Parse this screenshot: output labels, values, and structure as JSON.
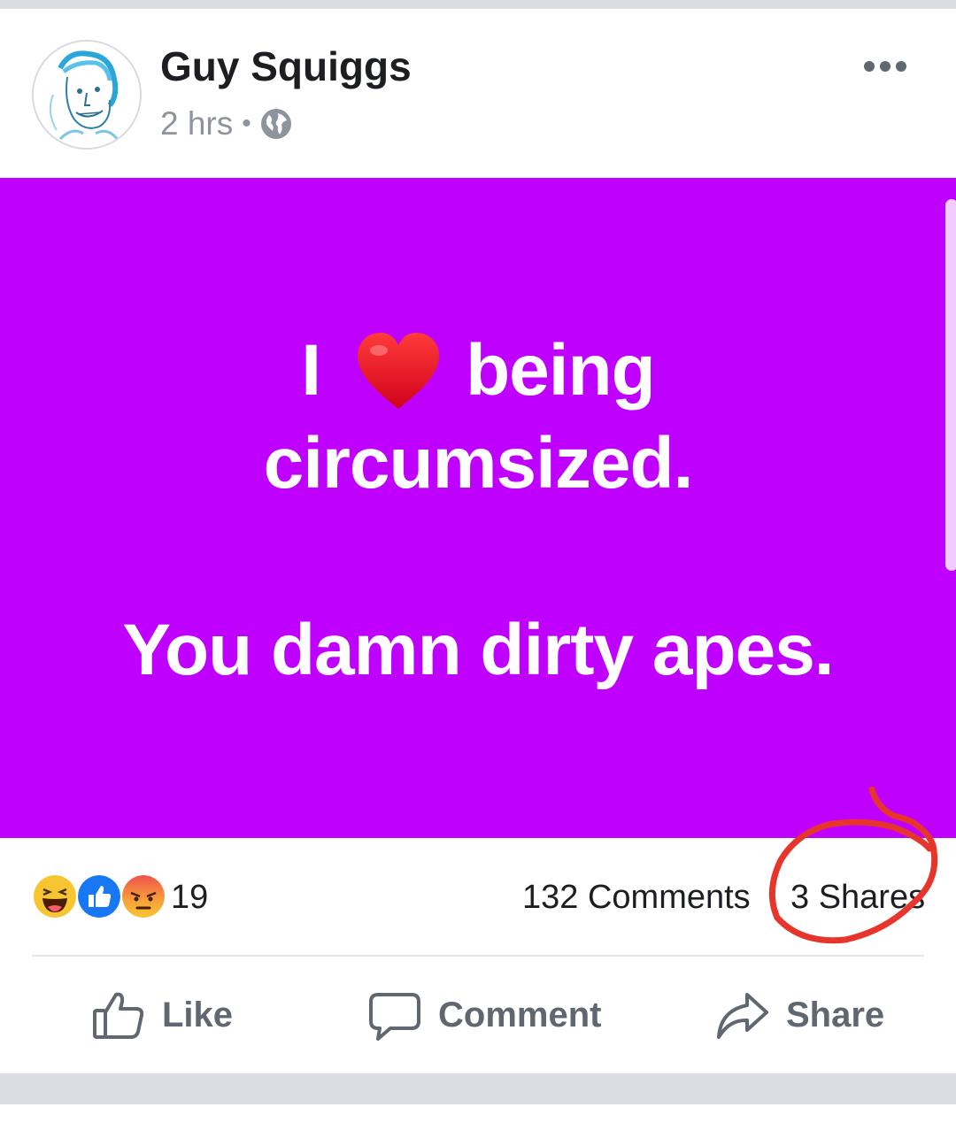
{
  "post": {
    "author": "Guy Squiggs",
    "timestamp": "2 hrs",
    "separator": "•",
    "privacy_icon": "globe-icon",
    "more_icon": "more-options-icon",
    "background_color": "#c000ff",
    "text_lines": [
      "I",
      "being",
      "circumsized.",
      "You damn dirty apes."
    ],
    "heart_icon": "red-heart-emoji"
  },
  "stats": {
    "reaction_icons": [
      "haha-reaction-icon",
      "like-reaction-icon",
      "angry-reaction-icon"
    ],
    "reaction_count": "19",
    "comments": "132 Comments",
    "shares": "3 Shares"
  },
  "actions": {
    "like": "Like",
    "comment": "Comment",
    "share": "Share"
  },
  "colors": {
    "accent_annotation": "#e8352b",
    "like_blue": "#1877f2"
  }
}
